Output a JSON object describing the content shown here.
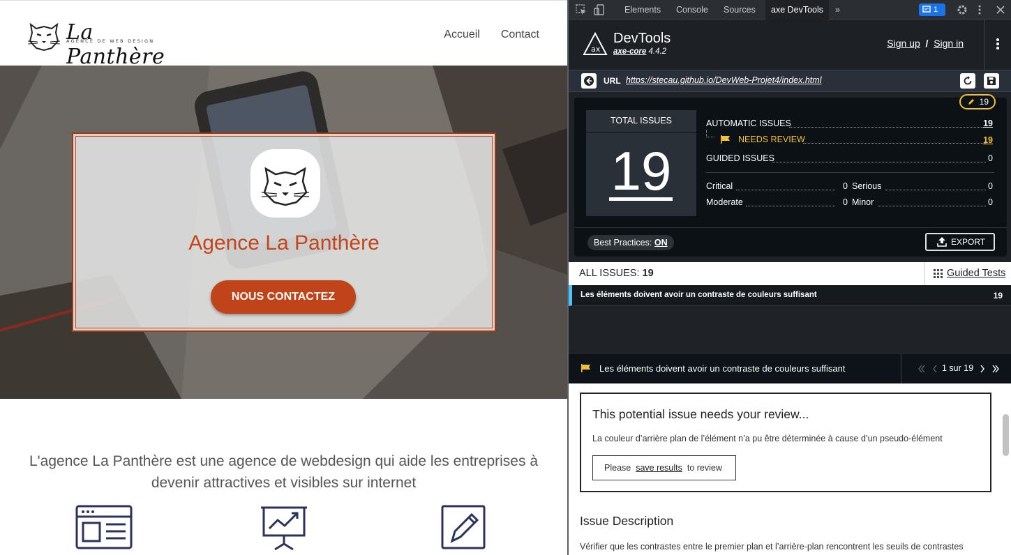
{
  "site": {
    "logo_text": "La Panthère",
    "logo_sub": "AGENCE DE WEB DESIGN",
    "nav": [
      "Accueil",
      "Contact"
    ],
    "hero_title": "Agence La Panthère",
    "hero_button": "NOUS CONTACTEZ",
    "intro": "L'agence La Panthère est une agence de webdesign qui aide les entreprises à devenir attractives et visibles sur internet",
    "service_icons": [
      "web-page-icon",
      "presentation-chart-icon",
      "pencil-edit-icon"
    ],
    "colors": {
      "accent": "#c1431a",
      "hero_card": "#e8e8e8"
    }
  },
  "devtools": {
    "tabs": [
      "Elements",
      "Console",
      "Sources",
      "axe DevTools"
    ],
    "active_tab": "axe DevTools",
    "issues_badge": "1",
    "more_tabs_glyph": "»",
    "axe": {
      "title": "DevTools",
      "core_name": "axe-core",
      "core_version": "4.4.2",
      "sign_up": "Sign up",
      "auth_sep": "/",
      "sign_in": "Sign in",
      "url_label": "URL",
      "url": "https://stecau.github.io/DevWeb-Projet4/index.html"
    },
    "summary": {
      "pen_count": "19",
      "total_label": "TOTAL ISSUES",
      "total": "19",
      "automatic_label": "AUTOMATIC ISSUES",
      "automatic": "19",
      "needs_review_label": "NEEDS REVIEW",
      "needs_review": "19",
      "guided_label": "GUIDED ISSUES",
      "guided": "0",
      "critical_label": "Critical",
      "critical": "0",
      "serious_label": "Serious",
      "serious": "0",
      "moderate_label": "Moderate",
      "moderate": "0",
      "minor_label": "Minor",
      "minor": "0",
      "best_practices_label": "Best Practices:",
      "best_practices_value": "ON",
      "export_label": "EXPORT"
    },
    "issues": {
      "all_label": "ALL ISSUES:",
      "all_count": "19",
      "guided_tests": "Guided Tests",
      "rows": [
        {
          "title": "Les éléments doivent avoir un contraste de couleurs suffisant",
          "count": "19"
        }
      ]
    },
    "detail": {
      "title": "Les éléments doivent avoir un contraste de couleurs suffisant",
      "pager": "1 sur 19",
      "review_title": "This potential issue needs your review...",
      "review_text": "La couleur d’arrière plan de l’élément n’a pu être déterminée à cause d’un pseudo-élément",
      "review_btn_pre": "Please",
      "review_btn_link": "save results",
      "review_btn_post": "to review",
      "desc_title": "Issue Description",
      "desc_text": "Vérifier que les contrastes entre le premier plan et l’arrière-plan rencontrent les seuils de contrastes"
    },
    "colors": {
      "panel": "#1f2327",
      "summary": "#0c1116",
      "highlight": "#f2c230",
      "selected_row": "#4fc3f7"
    }
  }
}
